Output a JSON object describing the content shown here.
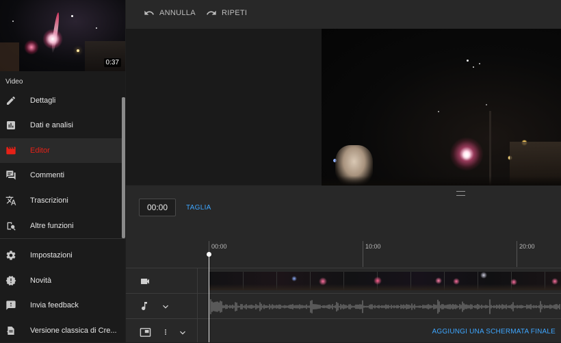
{
  "thumbnail": {
    "duration": "0:37"
  },
  "sidebar": {
    "section_label": "Video",
    "items": [
      {
        "label": "Dettagli",
        "icon": "pencil-icon"
      },
      {
        "label": "Dati e analisi",
        "icon": "analytics-icon"
      },
      {
        "label": "Editor",
        "icon": "clapperboard-icon",
        "active": true
      },
      {
        "label": "Commenti",
        "icon": "comment-icon"
      },
      {
        "label": "Trascrizioni",
        "icon": "translate-icon"
      },
      {
        "label": "Altre funzioni",
        "icon": "more-features-icon"
      }
    ],
    "bottom_items": [
      {
        "label": "Impostazioni",
        "icon": "gear-icon"
      },
      {
        "label": "Novità",
        "icon": "alert-badge-icon"
      },
      {
        "label": "Invia feedback",
        "icon": "feedback-icon"
      },
      {
        "label": "Versione classica di Cre...",
        "icon": "classic-version-icon"
      }
    ]
  },
  "toolbar": {
    "undo_label": "ANNULLA",
    "redo_label": "RIPETI"
  },
  "controls": {
    "time_value": "00:00",
    "trim_label": "TAGLIA"
  },
  "timeline": {
    "ticks": [
      "00:00",
      "10:00",
      "20:00"
    ],
    "end_screen_label": "AGGIUNGI UNA SCHERMATA FINALE"
  },
  "colors": {
    "accent_red": "#e62117",
    "link_blue": "#3ea6ff",
    "background": "#282828"
  }
}
